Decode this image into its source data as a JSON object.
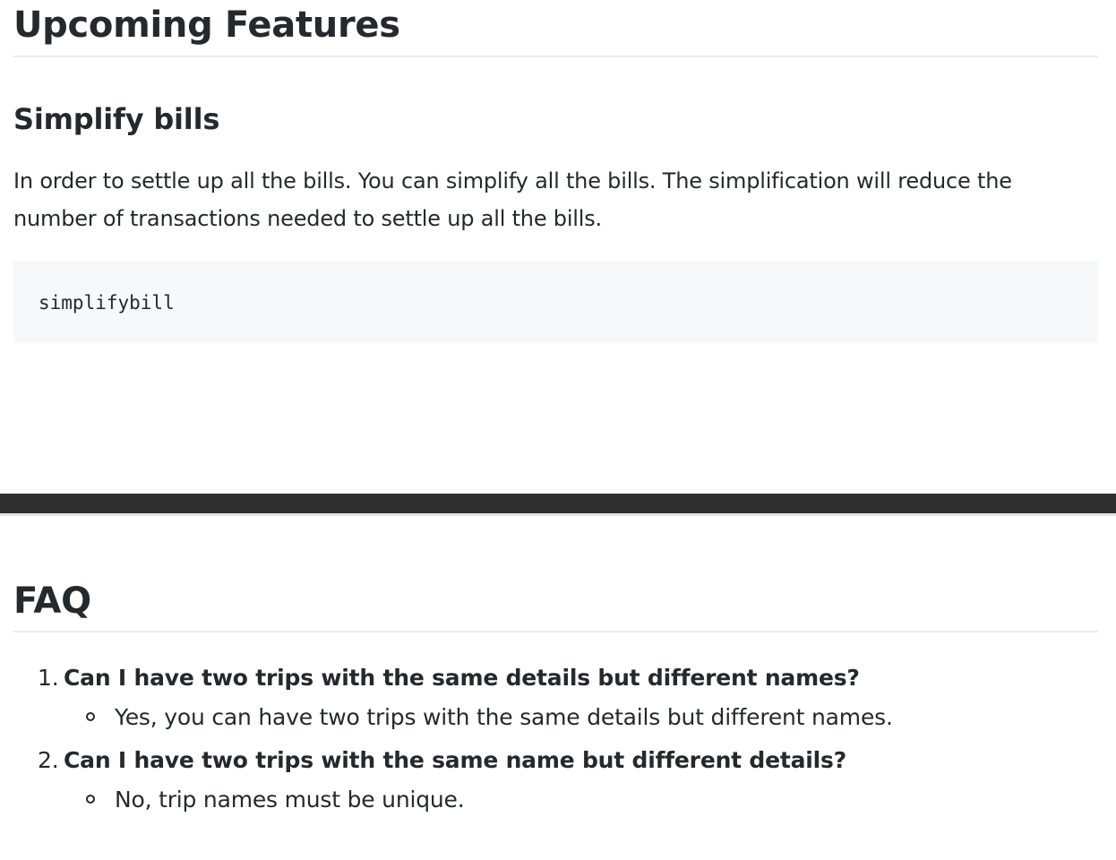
{
  "upcoming": {
    "title": "Upcoming Features",
    "section": {
      "title": "Simplify bills",
      "description": "In order to settle up all the bills. You can simplify all the bills. The simplification will reduce the number of transactions needed to settle up all the bills.",
      "code": "simplifybill"
    }
  },
  "faq": {
    "title": "FAQ",
    "items": [
      {
        "number": "1.",
        "question": "Can I have two trips with the same details but different names?",
        "answer": "Yes, you can have two trips with the same details but different names."
      },
      {
        "number": "2.",
        "question": "Can I have two trips with the same name but different details?",
        "answer": "No, trip names must be unique."
      }
    ]
  }
}
